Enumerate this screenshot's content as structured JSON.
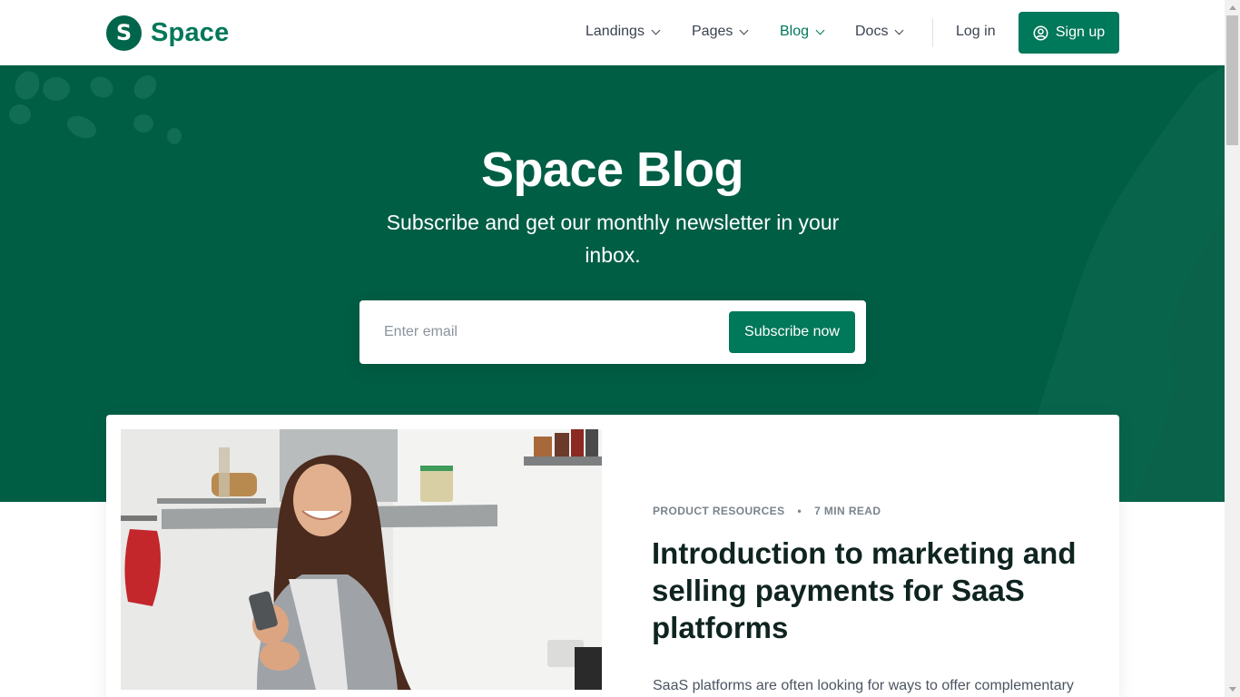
{
  "brand": {
    "logo_letter": "S",
    "name": "Space"
  },
  "nav": {
    "items": [
      {
        "label": "Landings",
        "active": false
      },
      {
        "label": "Pages",
        "active": false
      },
      {
        "label": "Blog",
        "active": true
      },
      {
        "label": "Docs",
        "active": false
      }
    ],
    "login_label": "Log in",
    "signup_label": "Sign up"
  },
  "hero": {
    "title": "Space Blog",
    "subtitle": "Subscribe and get our monthly newsletter in your inbox.",
    "email_placeholder": "Enter email",
    "email_value": "",
    "subscribe_label": "Subscribe now"
  },
  "featured_post": {
    "category": "PRODUCT RESOURCES",
    "separator": "•",
    "read_time": "7 MIN READ",
    "title": "Introduction to marketing and selling payments for SaaS platforms",
    "excerpt": "SaaS platforms are often looking for ways to offer complementary"
  },
  "colors": {
    "brand": "#00785a",
    "hero_bg": "#005e45",
    "text_dark": "#0f2420",
    "text_muted": "#7a838c"
  },
  "icons": {
    "signup": "user-circle-icon",
    "nav_dropdown": "chevron-down-icon"
  }
}
